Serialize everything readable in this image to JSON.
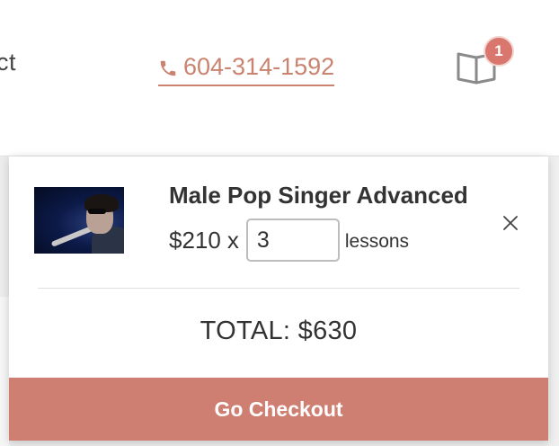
{
  "header": {
    "nav_fragment": "ct",
    "phone": {
      "icon": "phone-icon",
      "label": "604-314-1592"
    },
    "cart": {
      "icon": "book-icon",
      "badge_count": "1"
    }
  },
  "cart_panel": {
    "item": {
      "title": "Male Pop Singer Advanced",
      "price": "$210",
      "multiply": "x",
      "quantity": "3",
      "unit": "lessons",
      "thumbnail": "singer-photo",
      "remove_icon": "close-icon"
    },
    "total": "TOTAL: $630",
    "checkout_label": "Go Checkout"
  },
  "colors": {
    "accent": "#c9836f",
    "badge": "#d9766d",
    "checkout": "#cf7f72"
  }
}
